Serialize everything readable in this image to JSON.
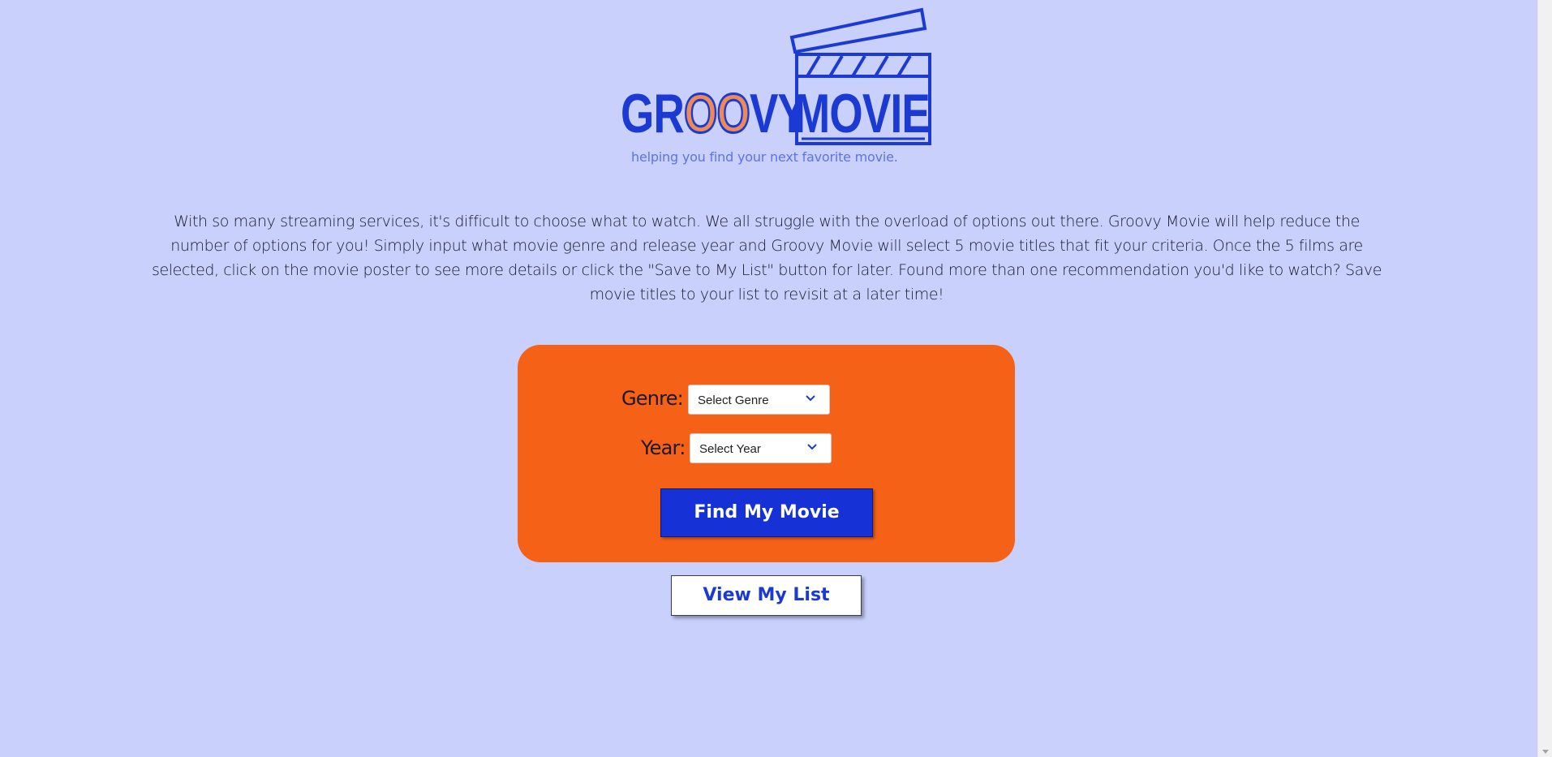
{
  "logo": {
    "word_left_prefix": "GR",
    "word_left_oo": "OO",
    "word_left_suffix": "VY",
    "word_right": "MOVIE",
    "tagline": "helping you find your next favorite movie.",
    "icon": "clapperboard-icon"
  },
  "intro": {
    "text": "With so many streaming services, it's difficult to choose what to watch. We all struggle with the overload of options out there. Groovy Movie will help reduce the number of options for you! Simply input what movie genre and release year and Groovy Movie will select 5 movie titles that fit your criteria. Once the 5 films are selected, click on the movie poster to see more details or click the \"Save to My List\" button for later. Found more than one recommendation you'd like to watch? Save movie titles to your list to revisit at a later time!"
  },
  "search": {
    "genre_label": "Genre:",
    "genre_value": "Select Genre",
    "year_label": "Year:",
    "year_value": "Select Year",
    "submit_label": "Find My Movie"
  },
  "list_button": {
    "label": "View My List"
  },
  "colors": {
    "background": "#c8d0fb",
    "brand_blue": "#1b3ad3",
    "card_orange": "#f46117",
    "accent_orange": "#f08a55"
  }
}
